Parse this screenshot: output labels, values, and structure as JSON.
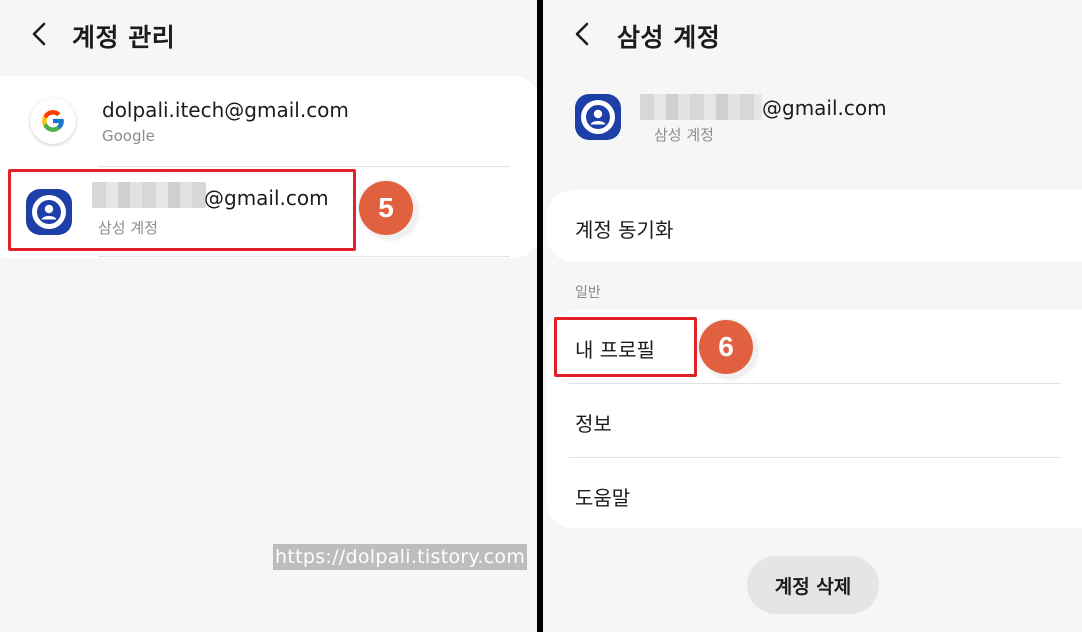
{
  "left_screen": {
    "title": "계정 관리",
    "accounts": [
      {
        "email": "dolpali.itech@gmail.com",
        "type": "Google",
        "icon": "google-icon"
      },
      {
        "email_suffix": "@gmail.com",
        "type": "삼성 계정",
        "icon": "samsung-account-icon"
      }
    ],
    "step_badge": "5",
    "watermark": "https://dolpali.tistory.com"
  },
  "right_screen": {
    "title": "삼성 계정",
    "account": {
      "email_suffix": "@gmail.com",
      "type": "삼성 계정",
      "icon": "samsung-account-icon"
    },
    "sync_label": "계정 동기화",
    "section_general": "일반",
    "menu": [
      "내 프로필",
      "정보",
      "도움말"
    ],
    "step_badge": "6",
    "delete_button": "계정 삭제"
  },
  "colors": {
    "highlight": "#e02228",
    "badge": "#e0603f",
    "samsung_blue": "#1f3fa8",
    "background": "#f6f6f6"
  }
}
